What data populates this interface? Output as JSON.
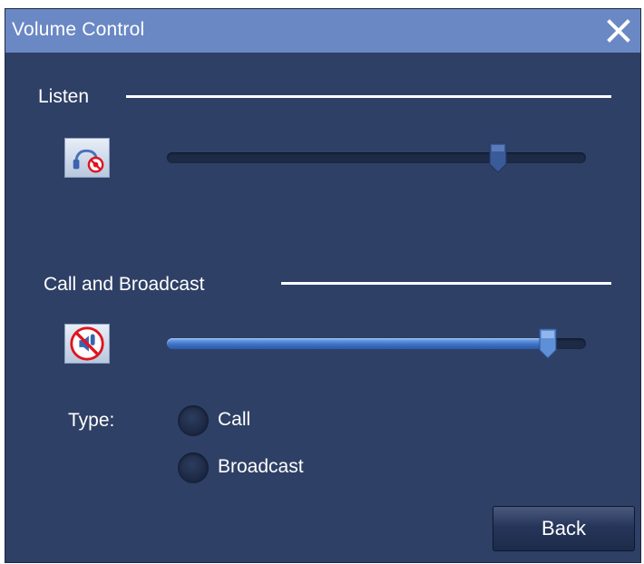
{
  "window": {
    "title": "Volume Control"
  },
  "listen": {
    "label": "Listen",
    "mute_icon": "headset-muted-icon",
    "volume": 0.79
  },
  "call_broadcast": {
    "label": "Call and Broadcast",
    "mute_icon": "speaker-muted-icon",
    "volume": 0.91
  },
  "type": {
    "label": "Type:",
    "options": [
      "Call",
      "Broadcast"
    ],
    "selected": null
  },
  "buttons": {
    "back": "Back"
  },
  "colors": {
    "window_bg": "#2f4066",
    "titlebar_bg": "#6a88c4",
    "slider_fill": "#3e72c8",
    "mute_red": "#e0141e"
  }
}
